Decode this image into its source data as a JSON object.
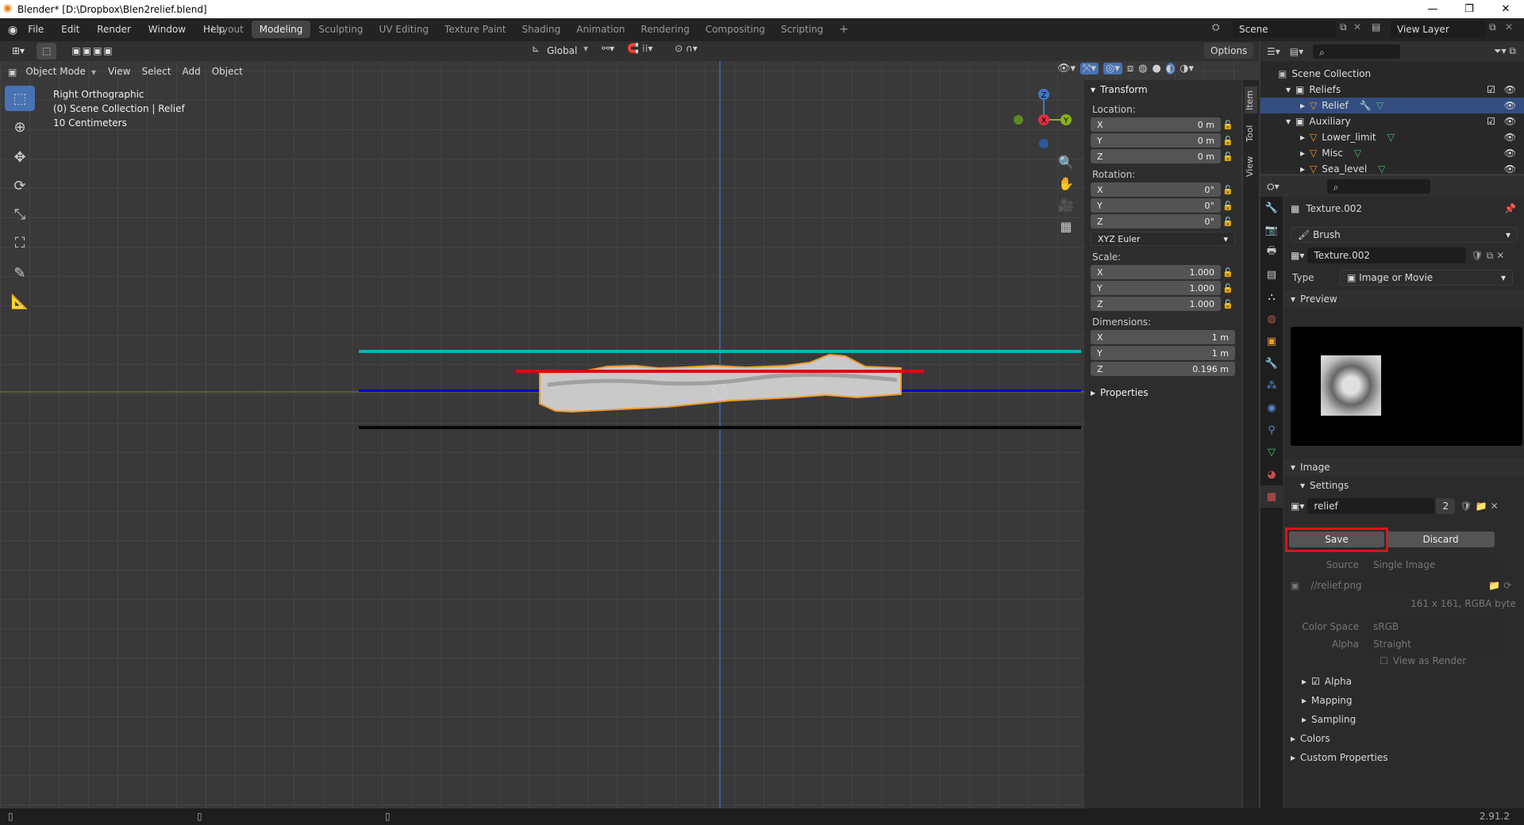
{
  "window": {
    "title": "Blender* [D:\\Dropbox\\Blen2relief.blend]"
  },
  "menu": [
    "File",
    "Edit",
    "Render",
    "Window",
    "Help"
  ],
  "workspaces": [
    "Layout",
    "Modeling",
    "Sculpting",
    "UV Editing",
    "Texture Paint",
    "Shading",
    "Animation",
    "Rendering",
    "Compositing",
    "Scripting"
  ],
  "active_workspace": "Modeling",
  "scene": "Scene",
  "view_layer": "View Layer",
  "header3d": {
    "mode": "Object Mode",
    "menus": [
      "View",
      "Select",
      "Add",
      "Object"
    ],
    "orientation": "Global",
    "options": "Options"
  },
  "viewport": {
    "view_name": "Right Orthographic",
    "collection": "(0) Scene Collection | Relief",
    "scale": "10 Centimeters"
  },
  "gizmo": {
    "z": "Z",
    "x": "X",
    "y": "Y"
  },
  "npanel": {
    "transform_title": "Transform",
    "location_label": "Location:",
    "location": [
      {
        "axis": "X",
        "value": "0 m"
      },
      {
        "axis": "Y",
        "value": "0 m"
      },
      {
        "axis": "Z",
        "value": "0 m"
      }
    ],
    "rotation_label": "Rotation:",
    "rotation": [
      {
        "axis": "X",
        "value": "0°"
      },
      {
        "axis": "Y",
        "value": "0°"
      },
      {
        "axis": "Z",
        "value": "0°"
      }
    ],
    "rotation_mode": "XYZ Euler",
    "scale_label": "Scale:",
    "scale": [
      {
        "axis": "X",
        "value": "1.000"
      },
      {
        "axis": "Y",
        "value": "1.000"
      },
      {
        "axis": "Z",
        "value": "1.000"
      }
    ],
    "dimensions_label": "Dimensions:",
    "dimensions": [
      {
        "axis": "X",
        "value": "1 m"
      },
      {
        "axis": "Y",
        "value": "1 m"
      },
      {
        "axis": "Z",
        "value": "0.196 m"
      }
    ],
    "properties_title": "Properties",
    "side_tabs": [
      "Item",
      "Tool",
      "View"
    ]
  },
  "outliner": {
    "root": "Scene Collection",
    "rows": [
      {
        "name": "Reliefs",
        "indent": 1
      },
      {
        "name": "Relief",
        "indent": 2
      },
      {
        "name": "Auxiliary",
        "indent": 1
      },
      {
        "name": "Lower_limit",
        "indent": 2
      },
      {
        "name": "Misc",
        "indent": 2
      },
      {
        "name": "Sea_level",
        "indent": 2
      }
    ]
  },
  "properties": {
    "texture_name": "Texture.002",
    "context": "Brush",
    "datablock": "Texture.002",
    "type_label": "Type",
    "type_value": "Image or Movie",
    "preview_label": "Preview",
    "image_label": "Image",
    "settings_label": "Settings",
    "image_name": "relief",
    "image_users": "2",
    "save_label": "Save",
    "discard_label": "Discard",
    "source_label": "Source",
    "source_value": "Single Image",
    "filepath": "//relief.png",
    "image_info": "161 x 161,  RGBA byte",
    "colorspace_label": "Color Space",
    "colorspace_value": "sRGB",
    "alpha_label": "Alpha",
    "alpha_value": "Straight",
    "view_as_render": "View as Render",
    "alpha_check": "Alpha",
    "mapping": "Mapping",
    "sampling": "Sampling",
    "colors": "Colors",
    "custom_properties": "Custom Properties"
  },
  "status": {
    "version": "2.91.2"
  },
  "colors": {
    "accent": "#4772b3",
    "highlight_red": "#e0101a",
    "cyan_line": "#00b4b4",
    "blue_line": "#0000c8",
    "red_line": "#d01010"
  }
}
